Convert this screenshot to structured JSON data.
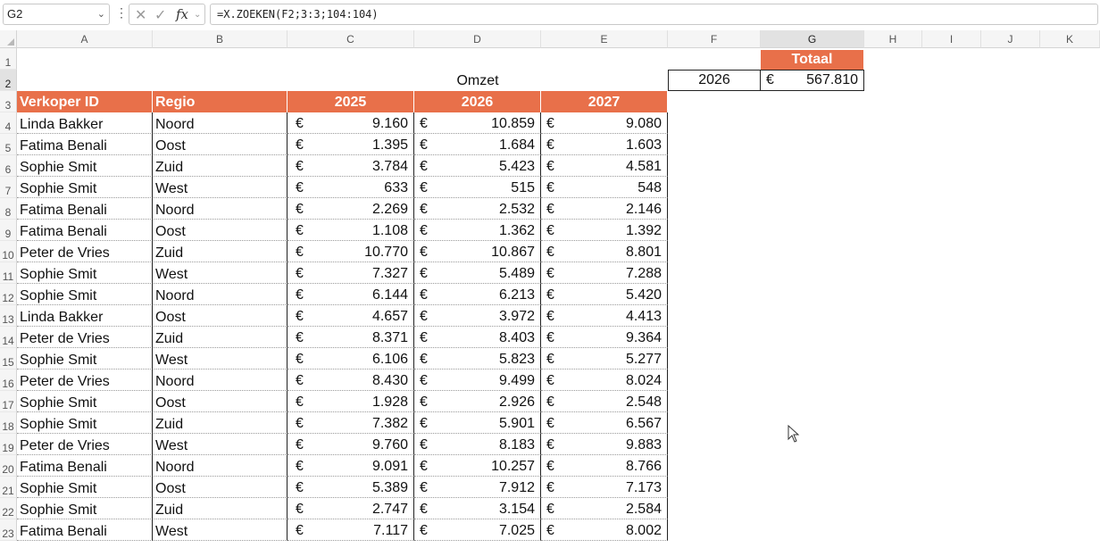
{
  "formula_bar": {
    "name_box": "G2",
    "formula": "=X.ZOEKEN(F2;3:3;104:104)"
  },
  "icons": {
    "cancel": "close-icon",
    "enter": "check-icon",
    "function": "fx-icon"
  },
  "columns": [
    "A",
    "B",
    "C",
    "D",
    "E",
    "F",
    "G",
    "H",
    "I",
    "J",
    "K"
  ],
  "rows": [
    "1",
    "2",
    "3",
    "4",
    "5",
    "6",
    "7",
    "8",
    "9",
    "10",
    "11",
    "12",
    "13",
    "14",
    "15",
    "16",
    "17",
    "18",
    "19",
    "20",
    "21",
    "22",
    "23"
  ],
  "colors": {
    "accent": "#e8704a"
  },
  "lookup": {
    "header": "Totaal",
    "omzet_label": "Omzet",
    "year": "2026",
    "currency": "€",
    "total": "567.810"
  },
  "table": {
    "headers": [
      "Verkoper ID",
      "Regio",
      "2025",
      "2026",
      "2027"
    ],
    "currency": "€",
    "rows": [
      [
        "Linda Bakker",
        "Noord",
        "9.160",
        "10.859",
        "9.080"
      ],
      [
        "Fatima Benali",
        "Oost",
        "1.395",
        "1.684",
        "1.603"
      ],
      [
        "Sophie Smit",
        "Zuid",
        "3.784",
        "5.423",
        "4.581"
      ],
      [
        "Sophie Smit",
        "West",
        "633",
        "515",
        "548"
      ],
      [
        "Fatima Benali",
        "Noord",
        "2.269",
        "2.532",
        "2.146"
      ],
      [
        "Fatima Benali",
        "Oost",
        "1.108",
        "1.362",
        "1.392"
      ],
      [
        "Peter de Vries",
        "Zuid",
        "10.770",
        "10.867",
        "8.801"
      ],
      [
        "Sophie Smit",
        "West",
        "7.327",
        "5.489",
        "7.288"
      ],
      [
        "Sophie Smit",
        "Noord",
        "6.144",
        "6.213",
        "5.420"
      ],
      [
        "Linda Bakker",
        "Oost",
        "4.657",
        "3.972",
        "4.413"
      ],
      [
        "Peter de Vries",
        "Zuid",
        "8.371",
        "8.403",
        "9.364"
      ],
      [
        "Sophie Smit",
        "West",
        "6.106",
        "5.823",
        "5.277"
      ],
      [
        "Peter de Vries",
        "Noord",
        "8.430",
        "9.499",
        "8.024"
      ],
      [
        "Sophie Smit",
        "Oost",
        "1.928",
        "2.926",
        "2.548"
      ],
      [
        "Sophie Smit",
        "Zuid",
        "7.382",
        "5.901",
        "6.567"
      ],
      [
        "Peter de Vries",
        "West",
        "9.760",
        "8.183",
        "9.883"
      ],
      [
        "Fatima Benali",
        "Noord",
        "9.091",
        "10.257",
        "8.766"
      ],
      [
        "Sophie Smit",
        "Oost",
        "5.389",
        "7.912",
        "7.173"
      ],
      [
        "Sophie Smit",
        "Zuid",
        "2.747",
        "3.154",
        "2.584"
      ],
      [
        "Fatima Benali",
        "West",
        "7.117",
        "7.025",
        "8.002"
      ]
    ]
  }
}
